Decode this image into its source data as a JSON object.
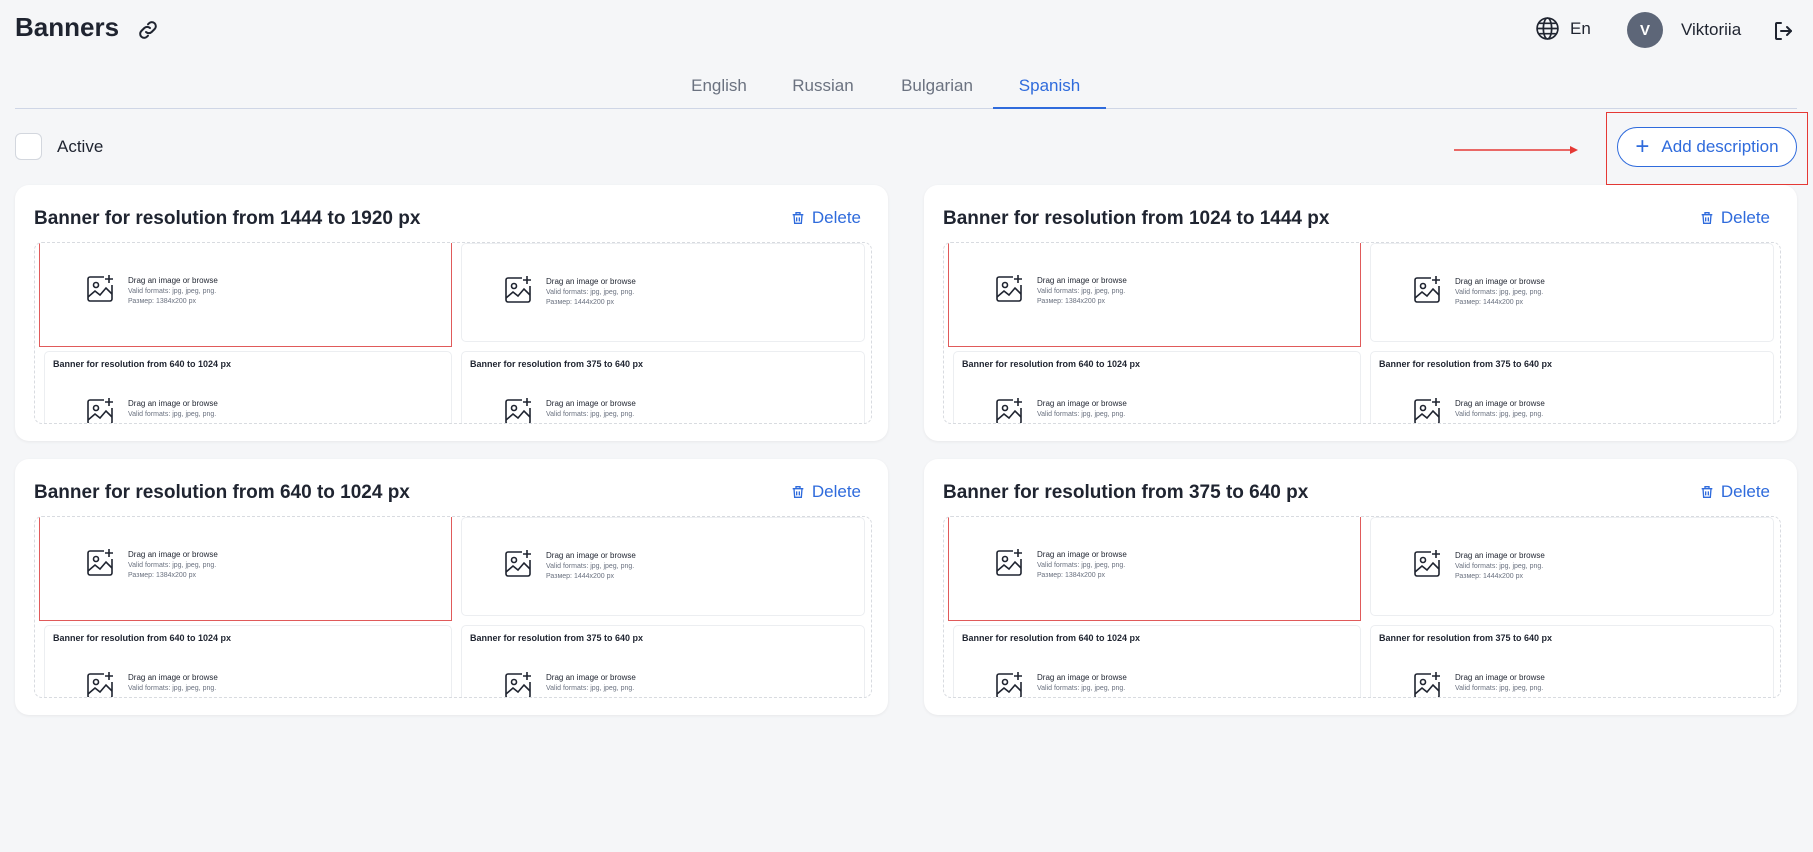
{
  "header": {
    "title": "Banners",
    "lang_label": "En",
    "avatar_letter": "V",
    "user_name": "Viktoriia"
  },
  "tabs": [
    {
      "label": "English"
    },
    {
      "label": "Russian"
    },
    {
      "label": "Bulgarian"
    },
    {
      "label": "Spanish",
      "active": true
    }
  ],
  "active_label": "Active",
  "add_button_label": "Add description",
  "delete_label": "Delete",
  "cards": [
    {
      "title": "Banner for resolution from 1444 to 1920 px"
    },
    {
      "title": "Banner for resolution from 1024 to 1444 px"
    },
    {
      "title": "Banner for resolution from 640 to 1024 px"
    },
    {
      "title": "Banner for resolution from 375 to 640 px"
    }
  ],
  "preview": {
    "drop_text": "Drag an image or browse",
    "formats_top": "Valid formats: jpg, jpeg, png.",
    "formats_bottom": "Valid formats: jpg, jpeg, png.",
    "size_a": "Размер: 1384x200 px",
    "size_b": "Размер: 1444x200 px",
    "sub_title_a": "Banner for resolution from 640 to 1024 px",
    "sub_title_b": "Banner for resolution from 375 to 640 px"
  },
  "colors": {
    "accent": "#2f6bdc",
    "annotation": "#e53935",
    "background": "#f5f6f8"
  }
}
